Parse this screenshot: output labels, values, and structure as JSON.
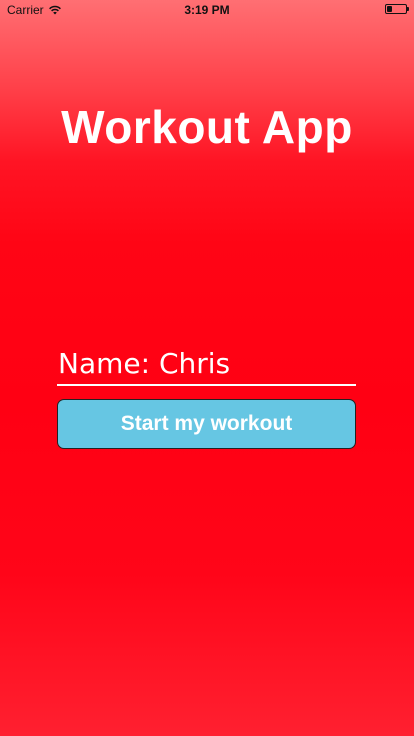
{
  "status_bar": {
    "carrier": "Carrier",
    "time": "3:19 PM",
    "wifi_icon": "wifi-icon",
    "battery_icon": "battery-icon"
  },
  "title": "Workout App",
  "name_field": {
    "value": "Name: Chris"
  },
  "start_button": {
    "label": "Start my workout"
  },
  "colors": {
    "background": "#ff0013",
    "button": "#66c6e3",
    "text": "#ffffff"
  }
}
